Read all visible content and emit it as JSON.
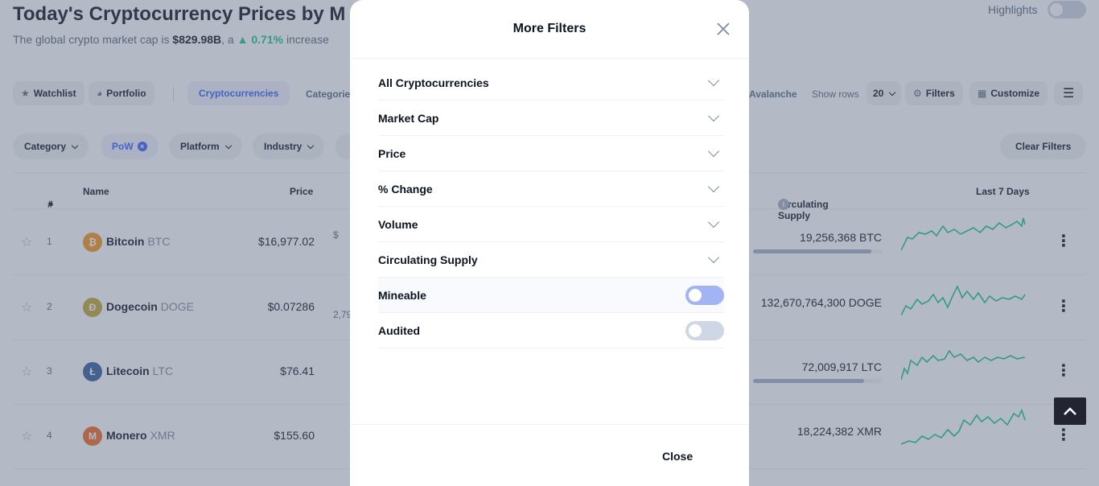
{
  "header": {
    "title": "Today's Cryptocurrency Prices by M",
    "subtitle_prefix": "The global crypto market cap is",
    "market_cap": "$829.98B",
    "subtitle_mid": ", a",
    "change": "0.71%",
    "subtitle_suffix": "increase",
    "highlights_label": "Highlights"
  },
  "toolbar": {
    "watchlist": "Watchlist",
    "portfolio": "Portfolio",
    "cryptocurrencies": "Cryptocurrencies",
    "categories": "Categorie",
    "avalanche": "Avalanche",
    "show_rows_label": "Show rows",
    "show_rows_value": "20",
    "filters": "Filters",
    "customize": "Customize"
  },
  "filter_bar": {
    "category": "Category",
    "pow": "PoW",
    "platform": "Platform",
    "industry": "Industry",
    "clear": "Clear Filters"
  },
  "table": {
    "headers": {
      "rank": "#",
      "name": "Name",
      "price": "Price",
      "supply": "Circulating Supply",
      "last7": "Last 7 Days"
    },
    "rows": [
      {
        "rank": "1",
        "name": "Bitcoin",
        "symbol": "BTC",
        "price": "$16,977.02",
        "supply": "19,256,368 BTC",
        "supply_fill": 0.92,
        "coin_color": "#f7931a",
        "coin_glyph": "₿",
        "vol_hint": "$"
      },
      {
        "rank": "2",
        "name": "Dogecoin",
        "symbol": "DOGE",
        "price": "$0.07286",
        "supply": "132,670,764,300 DOGE",
        "supply_fill": 0,
        "coin_color": "#c2a633",
        "coin_glyph": "Ð",
        "vol_hint": "2,79"
      },
      {
        "rank": "3",
        "name": "Litecoin",
        "symbol": "LTC",
        "price": "$76.41",
        "supply": "72,009,917 LTC",
        "supply_fill": 0.86,
        "coin_color": "#345d9d",
        "coin_glyph": "Ł",
        "vol_hint": ""
      },
      {
        "rank": "4",
        "name": "Monero",
        "symbol": "XMR",
        "price": "$155.60",
        "supply": "18,224,382 XMR",
        "supply_fill": 0,
        "coin_color": "#f26822",
        "coin_glyph": "M",
        "vol_hint": ""
      }
    ]
  },
  "modal": {
    "title": "More Filters",
    "filters": [
      {
        "label": "All Cryptocurrencies",
        "kind": "dropdown"
      },
      {
        "label": "Market Cap",
        "kind": "dropdown"
      },
      {
        "label": "Price",
        "kind": "dropdown"
      },
      {
        "label": "% Change",
        "kind": "dropdown"
      },
      {
        "label": "Volume",
        "kind": "dropdown"
      },
      {
        "label": "Circulating Supply",
        "kind": "dropdown"
      },
      {
        "label": "Mineable",
        "kind": "toggle",
        "state": "on"
      },
      {
        "label": "Audited",
        "kind": "toggle",
        "state": "off"
      }
    ],
    "close_label": "Close"
  },
  "colors": {
    "accent": "#3861fb",
    "positive": "#16c784",
    "spark": "#16c784"
  }
}
